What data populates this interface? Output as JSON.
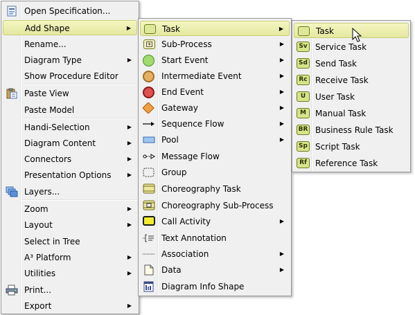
{
  "menu_main": {
    "items": [
      {
        "label": "Open Specification...",
        "icon": "specification-icon",
        "submenu": false
      },
      {
        "label": "Add Shape",
        "icon": "",
        "submenu": true,
        "highlight": true
      },
      {
        "label": "Rename...",
        "icon": "",
        "submenu": false
      },
      {
        "label": "Diagram Type",
        "icon": "",
        "submenu": true
      },
      {
        "label": "Show Procedure Editor",
        "icon": "",
        "submenu": false
      },
      {
        "label": "Paste View",
        "icon": "clipboard-icon",
        "submenu": false
      },
      {
        "label": "Paste Model",
        "icon": "",
        "submenu": false
      },
      {
        "label": "Handi-Selection",
        "icon": "",
        "submenu": true
      },
      {
        "label": "Diagram Content",
        "icon": "",
        "submenu": true
      },
      {
        "label": "Connectors",
        "icon": "",
        "submenu": true
      },
      {
        "label": "Presentation Options",
        "icon": "",
        "submenu": true
      },
      {
        "label": "Layers...",
        "icon": "layers-icon",
        "submenu": false
      },
      {
        "label": "Zoom",
        "icon": "",
        "submenu": true
      },
      {
        "label": "Layout",
        "icon": "",
        "submenu": true
      },
      {
        "label": "Select in Tree",
        "icon": "",
        "submenu": false
      },
      {
        "label": "A³ Platform",
        "icon": "",
        "submenu": true
      },
      {
        "label": "Utilities",
        "icon": "",
        "submenu": true
      },
      {
        "label": "Print...",
        "icon": "printer-icon",
        "submenu": false
      },
      {
        "label": "Export",
        "icon": "",
        "submenu": true
      }
    ]
  },
  "menu_shapes": {
    "items": [
      {
        "label": "Task",
        "icon": "task-icon",
        "submenu": true,
        "highlight": true
      },
      {
        "label": "Sub-Process",
        "icon": "sub-process-icon",
        "submenu": true
      },
      {
        "label": "Start Event",
        "icon": "start-event-icon",
        "submenu": true
      },
      {
        "label": "Intermediate Event",
        "icon": "intermediate-event-icon",
        "submenu": true
      },
      {
        "label": "End Event",
        "icon": "end-event-icon",
        "submenu": true
      },
      {
        "label": "Gateway",
        "icon": "gateway-icon",
        "submenu": true
      },
      {
        "label": "Sequence Flow",
        "icon": "sequence-flow-icon",
        "submenu": true
      },
      {
        "label": "Pool",
        "icon": "pool-icon",
        "submenu": true
      },
      {
        "label": "Message Flow",
        "icon": "message-flow-icon",
        "submenu": false
      },
      {
        "label": "Group",
        "icon": "group-icon",
        "submenu": false
      },
      {
        "label": "Choreography Task",
        "icon": "choreography-task-icon",
        "submenu": false
      },
      {
        "label": "Choreography Sub-Process",
        "icon": "choreography-sub-process-icon",
        "submenu": false
      },
      {
        "label": "Call Activity",
        "icon": "call-activity-icon",
        "submenu": true
      },
      {
        "label": "Text Annotation",
        "icon": "text-annotation-icon",
        "submenu": false
      },
      {
        "label": "Association",
        "icon": "association-icon",
        "submenu": true
      },
      {
        "label": "Data",
        "icon": "data-icon",
        "submenu": true
      },
      {
        "label": "Diagram Info Shape",
        "icon": "diagram-info-icon",
        "submenu": false
      }
    ]
  },
  "menu_tasks": {
    "items": [
      {
        "label": "Task",
        "tag": "",
        "icon": "task-icon",
        "highlight": true
      },
      {
        "label": "Service Task",
        "tag": "Sv",
        "icon": "service-task-icon"
      },
      {
        "label": "Send Task",
        "tag": "Sd",
        "icon": "send-task-icon"
      },
      {
        "label": "Receive Task",
        "tag": "Rc",
        "icon": "receive-task-icon"
      },
      {
        "label": "User Task",
        "tag": "U",
        "icon": "user-task-icon"
      },
      {
        "label": "Manual Task",
        "tag": "M",
        "icon": "manual-task-icon"
      },
      {
        "label": "Business Rule Task",
        "tag": "BR",
        "icon": "business-rule-task-icon"
      },
      {
        "label": "Script Task",
        "tag": "Sp",
        "icon": "script-task-icon"
      },
      {
        "label": "Reference Task",
        "tag": "Rf",
        "icon": "reference-task-icon"
      }
    ]
  },
  "colors": {
    "highlight": "#e9ecae",
    "menu_bg": "#f0f0f0",
    "task_fill": "#dde89a"
  }
}
